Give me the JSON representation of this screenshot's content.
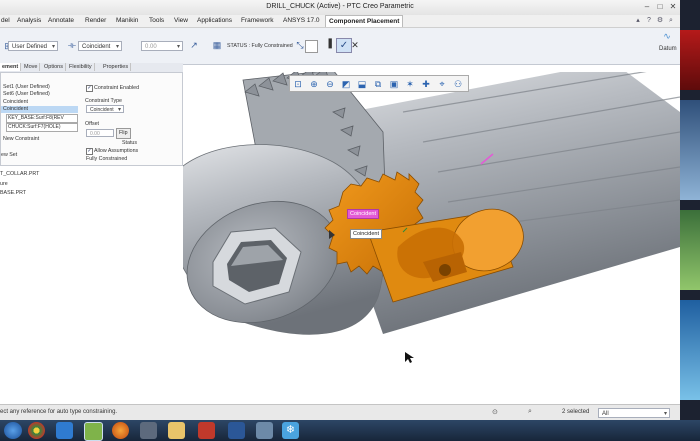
{
  "window": {
    "title": "DRILL_CHUCK (Active) - PTC Creo Parametric",
    "controls": [
      "minimize-icon",
      "maximize-icon",
      "close-icon"
    ]
  },
  "menu": {
    "items": [
      "del",
      "Analysis",
      "Annotate",
      "Render",
      "Manikin",
      "Tools",
      "View",
      "Applications",
      "Framework",
      "ANSYS 17.0",
      "Component Placement"
    ],
    "right_icons": [
      "minimize-icon",
      "help-icon",
      "gear-icon",
      "search-icon",
      "close-icon"
    ]
  },
  "dashboard": {
    "constraint_set": "User Defined",
    "constraint_type": "Coincident",
    "offset_value": "0.00",
    "status_label": "STATUS : Fully Constrained",
    "datum_label": "Datum",
    "icons": [
      "flip-icon",
      "placement-icon",
      "pause-icon",
      "checkmark-icon",
      "cancel-icon",
      "datum-icon"
    ]
  },
  "subtabs": [
    "ement",
    "Move",
    "Options",
    "Flexibility",
    "Properties"
  ],
  "placement_panel": {
    "sets": [
      "Set1 (User Defined)",
      "Set6 (User Defined)"
    ],
    "constraint_header": "Coincident",
    "selected_constraint": "Coincident",
    "references": [
      "KEY_BASE:Surf:F8(REV",
      "CHUCK:Surf:F7(HOLE)"
    ],
    "new_constraint": "New Constraint",
    "new_set": "ew Set",
    "constraint_enabled": "Constraint Enabled",
    "constraint_type_label": "Constraint Type",
    "constraint_type_value": "Coincident",
    "offset_label": "Offset",
    "offset_value": "0.00",
    "flip_label": "Flip",
    "status_header": "Status",
    "allow_assumptions": "Allow Assumptions",
    "status_text": "Fully Constrained"
  },
  "model_tree": {
    "items": [
      "T_COLLAR.PRT",
      "ure",
      "BASE.PRT"
    ]
  },
  "viewport": {
    "toolbar_icons": [
      "refit-icon",
      "zoom-in-icon",
      "zoom-out-icon",
      "repaint-icon",
      "view-normal-icon",
      "saved-views-icon",
      "display-style-icon",
      "datum-display-icon",
      "spin-center-icon",
      "annotation-display-icon",
      "appearance-icon"
    ],
    "label_coincident_pink": "Coincident",
    "label_coincident_white": "Coincident",
    "colors": {
      "chuck_body": "#9a9fa6",
      "key_part": "#e2880d",
      "highlight": "#e35ad6"
    }
  },
  "statusbar": {
    "message": "ect any reference for auto type constraining.",
    "selection_count": "2 selected",
    "filter": "All"
  },
  "taskbar": {
    "icons": [
      "chrome-icon",
      "ie-icon",
      "creo-icon",
      "firefox-icon",
      "media-player-icon",
      "folder-icon",
      "acrobat-icon",
      "word-icon",
      "tool-icon",
      "snowflake-icon"
    ]
  }
}
